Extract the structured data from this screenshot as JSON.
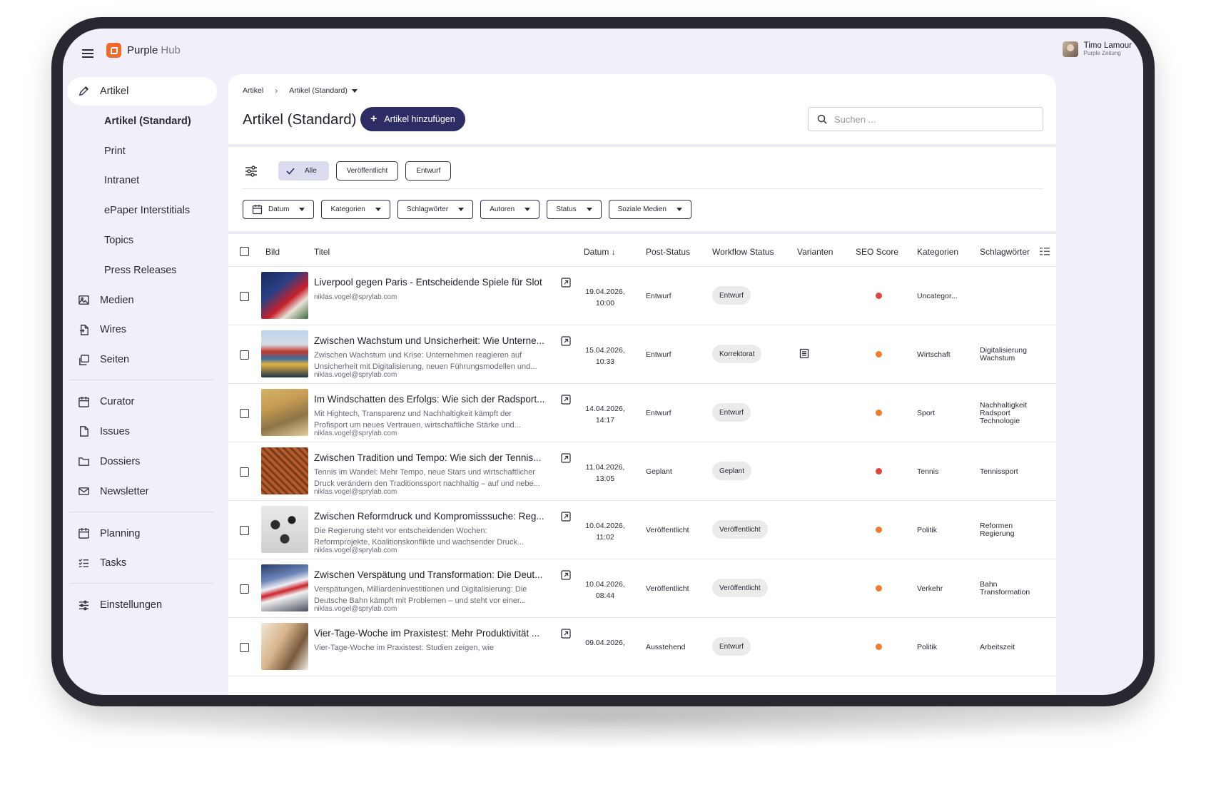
{
  "app": {
    "name": "Purple",
    "name_suffix": "Hub"
  },
  "user": {
    "name": "Timo Lamour",
    "org": "Purple Zeitung"
  },
  "sidebar": {
    "items": [
      {
        "label": "Artikel",
        "icon": "pencil-icon",
        "active": true
      },
      {
        "label": "Artikel (Standard)",
        "sub": true,
        "bold": true
      },
      {
        "label": "Print",
        "sub": true
      },
      {
        "label": "Intranet",
        "sub": true
      },
      {
        "label": "ePaper Interstitials",
        "sub": true
      },
      {
        "label": "Topics",
        "sub": true
      },
      {
        "label": "Press Releases",
        "sub": true
      },
      {
        "label": "Medien",
        "icon": "image-icon"
      },
      {
        "label": "Wires",
        "icon": "file-icon"
      },
      {
        "label": "Seiten",
        "icon": "pages-icon"
      },
      {
        "label": "Curator",
        "icon": "calendar-icon"
      },
      {
        "label": "Issues",
        "icon": "document-icon"
      },
      {
        "label": "Dossiers",
        "icon": "folder-icon"
      },
      {
        "label": "Newsletter",
        "icon": "mail-icon"
      },
      {
        "label": "Planning",
        "icon": "calendar-icon"
      },
      {
        "label": "Tasks",
        "icon": "checklist-icon"
      },
      {
        "label": "Einstellungen",
        "icon": "sliders-icon"
      }
    ]
  },
  "breadcrumb": {
    "root": "Artikel",
    "current": "Artikel (Standard)"
  },
  "page": {
    "title": "Artikel (Standard)",
    "add_button": "Artikel hinzufügen"
  },
  "search": {
    "placeholder": "Suchen ..."
  },
  "status_filters": [
    {
      "label": "Alle",
      "selected": true
    },
    {
      "label": "Veröffentlicht",
      "selected": false
    },
    {
      "label": "Entwurf",
      "selected": false
    }
  ],
  "dropdown_filters": [
    "Datum",
    "Kategorien",
    "Schlagwörter",
    "Autoren",
    "Status",
    "Soziale Medien"
  ],
  "table": {
    "columns": {
      "bild": "Bild",
      "titel": "Titel",
      "datum": "Datum",
      "post_status": "Post-Status",
      "workflow_status": "Workflow Status",
      "varianten": "Varianten",
      "seo_score": "SEO Score",
      "kategorien": "Kategorien",
      "schlagwoerter": "Schlagwörter"
    },
    "seo_colors": {
      "red": "#e0463f",
      "orange": "#ef7d2e"
    },
    "rows": [
      {
        "title": "Liverpool gegen Paris - Entscheidende Spiele für Slot",
        "teaser": [],
        "author": "niklas.vogel@sprylab.com",
        "date": "19.04.2026,",
        "time": "10:00",
        "post_status": "Entwurf",
        "workflow": "Entwurf",
        "variant": false,
        "seo": "red",
        "category": "Uncategor...",
        "tags": []
      },
      {
        "title": "Zwischen Wachstum und Unsicherheit: Wie Unterne...",
        "teaser": [
          "Zwischen Wachstum und Krise: Unternehmen reagieren auf",
          "Unsicherheit mit Digitalisierung, neuen Führungsmodellen und..."
        ],
        "author": "niklas.vogel@sprylab.com",
        "date": "15.04.2026,",
        "time": "10:33",
        "post_status": "Entwurf",
        "workflow": "Korrektorat",
        "variant": true,
        "seo": "orange",
        "category": "Wirtschaft",
        "tags": [
          "Digitalisierung",
          "Wachstum"
        ]
      },
      {
        "title": "Im Windschatten des Erfolgs: Wie sich der Radsport...",
        "teaser": [
          "Mit Hightech, Transparenz und Nachhaltigkeit kämpft der",
          "Profisport um neues Vertrauen, wirtschaftliche Stärke und..."
        ],
        "author": "niklas.vogel@sprylab.com",
        "date": "14.04.2026,",
        "time": "14:17",
        "post_status": "Entwurf",
        "workflow": "Entwurf",
        "variant": false,
        "seo": "orange",
        "category": "Sport",
        "tags": [
          "Nachhaltigkeit",
          "Radsport",
          "Technologie"
        ]
      },
      {
        "title": "Zwischen Tradition und Tempo: Wie sich der Tennis...",
        "teaser": [
          "Tennis im Wandel: Mehr Tempo, neue Stars und wirtschaftlicher",
          "Druck verändern den Traditionssport nachhaltig – auf und nebe..."
        ],
        "author": "niklas.vogel@sprylab.com",
        "date": "11.04.2026,",
        "time": "13:05",
        "post_status": "Geplant",
        "workflow": "Geplant",
        "variant": false,
        "seo": "red",
        "category": "Tennis",
        "tags": [
          "Tennissport"
        ]
      },
      {
        "title": "Zwischen Reformdruck und Kompromisssuche: Reg...",
        "teaser": [
          "Die Regierung steht vor entscheidenden Wochen:",
          "Reformprojekte, Koalitionskonflikte und wachsender Druck..."
        ],
        "author": "niklas.vogel@sprylab.com",
        "date": "10.04.2026,",
        "time": "11:02",
        "post_status": "Veröffentlicht",
        "workflow": "Veröffentlicht",
        "variant": false,
        "seo": "orange",
        "category": "Politik",
        "tags": [
          "Reformen",
          "Regierung"
        ]
      },
      {
        "title": "Zwischen Verspätung und Transformation: Die Deut...",
        "teaser": [
          "Verspätungen, Milliardeninvestitionen und Digitalisierung: Die",
          "Deutsche Bahn kämpft mit Problemen – und steht vor einer..."
        ],
        "author": "niklas.vogel@sprylab.com",
        "date": "10.04.2026,",
        "time": "08:44",
        "post_status": "Veröffentlicht",
        "workflow": "Veröffentlicht",
        "variant": false,
        "seo": "orange",
        "category": "Verkehr",
        "tags": [
          "Bahn",
          "Transformation"
        ]
      },
      {
        "title": "Vier-Tage-Woche im Praxistest: Mehr Produktivität ...",
        "teaser": [
          "Vier-Tage-Woche im Praxistest: Studien zeigen, wie"
        ],
        "author": "",
        "date": "09.04.2026,",
        "time": "",
        "post_status": "Ausstehend",
        "workflow": "Entwurf",
        "variant": false,
        "seo": "orange",
        "category": "Politik",
        "tags": [
          "Arbeitszeit"
        ]
      }
    ]
  }
}
